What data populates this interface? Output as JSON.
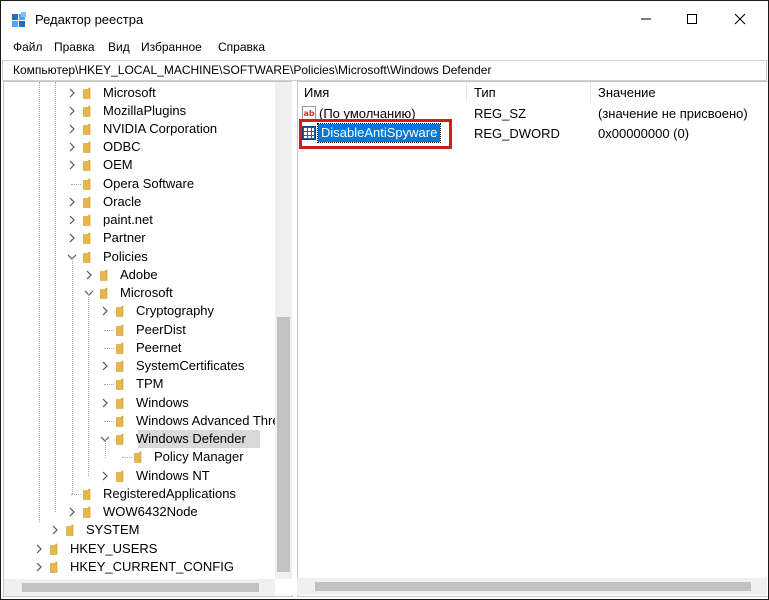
{
  "window": {
    "title": "Редактор реестра"
  },
  "menu": [
    "Файл",
    "Правка",
    "Вид",
    "Избранное",
    "Справка"
  ],
  "address": "Компьютер\\HKEY_LOCAL_MACHINE\\SOFTWARE\\Policies\\Microsoft\\Windows Defender",
  "tree": {
    "items": [
      {
        "label": "Microsoft",
        "expander": "collapsed"
      },
      {
        "label": "MozillaPlugins",
        "expander": "collapsed"
      },
      {
        "label": "NVIDIA Corporation",
        "expander": "collapsed"
      },
      {
        "label": "ODBC",
        "expander": "collapsed"
      },
      {
        "label": "OEM",
        "expander": "collapsed"
      },
      {
        "label": "Opera Software",
        "expander": "none"
      },
      {
        "label": "Oracle",
        "expander": "collapsed"
      },
      {
        "label": "paint.net",
        "expander": "collapsed"
      },
      {
        "label": "Partner",
        "expander": "collapsed"
      },
      {
        "label": "Policies",
        "expander": "expanded"
      },
      {
        "label": "Adobe",
        "expander": "collapsed"
      },
      {
        "label": "Microsoft",
        "expander": "expanded"
      },
      {
        "label": "Cryptography",
        "expander": "collapsed"
      },
      {
        "label": "PeerDist",
        "expander": "none"
      },
      {
        "label": "Peernet",
        "expander": "none"
      },
      {
        "label": "SystemCertificates",
        "expander": "collapsed"
      },
      {
        "label": "TPM",
        "expander": "none"
      },
      {
        "label": "Windows",
        "expander": "collapsed"
      },
      {
        "label": "Windows Advanced Threa",
        "expander": "none"
      },
      {
        "label": "Windows Defender",
        "expander": "expanded",
        "selected": true
      },
      {
        "label": "Policy Manager",
        "expander": "none"
      },
      {
        "label": "Windows NT",
        "expander": "collapsed"
      },
      {
        "label": "RegisteredApplications",
        "expander": "none"
      },
      {
        "label": "WOW6432Node",
        "expander": "collapsed"
      },
      {
        "label": "SYSTEM",
        "expander": "collapsed"
      },
      {
        "label": "HKEY_USERS",
        "expander": "collapsed"
      },
      {
        "label": "HKEY_CURRENT_CONFIG",
        "expander": "collapsed"
      }
    ]
  },
  "values": {
    "headers": [
      "Имя",
      "Тип",
      "Значение"
    ],
    "rows": [
      {
        "name": "(По умолчанию)",
        "type": "REG_SZ",
        "data": "(значение не присвоено)",
        "icon": "string-value-icon"
      },
      {
        "name": "DisableAntiSpyware",
        "type": "REG_DWORD",
        "data": "0x00000000 (0)",
        "icon": "dword-value-icon",
        "selected": true
      }
    ]
  },
  "colors": {
    "selection": "#0078d7",
    "highlight_box": "#d21c1c",
    "folder": "#e8b74a",
    "tree_selected": "#d9d9d9"
  }
}
